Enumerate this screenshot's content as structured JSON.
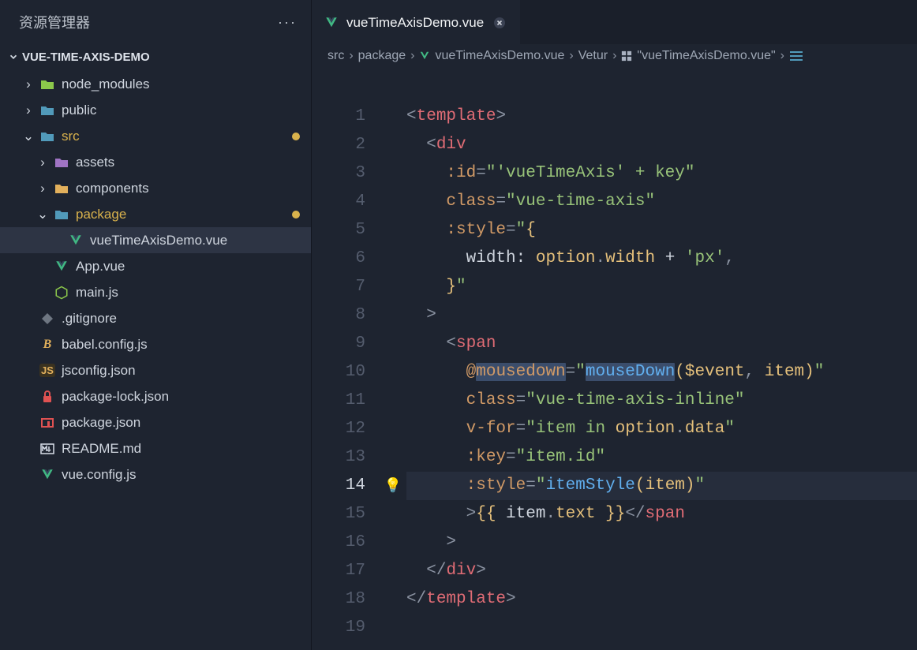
{
  "sidebar": {
    "title": "资源管理器",
    "section": "VUE-TIME-AXIS-DEMO",
    "items": [
      {
        "label": "node_modules",
        "depth": 1,
        "icon": "folder-node",
        "iconColor": "#8cc84b",
        "kind": "folder",
        "open": false,
        "mod": false
      },
      {
        "label": "public",
        "depth": 1,
        "icon": "folder-public",
        "iconColor": "#519aba",
        "kind": "folder",
        "open": false,
        "mod": false
      },
      {
        "label": "src",
        "depth": 1,
        "icon": "folder-src",
        "iconColor": "#519aba",
        "kind": "folder",
        "open": true,
        "mod": true
      },
      {
        "label": "assets",
        "depth": 2,
        "icon": "folder-assets",
        "iconColor": "#a074c4",
        "kind": "folder",
        "open": false,
        "mod": false
      },
      {
        "label": "components",
        "depth": 2,
        "icon": "folder-comp",
        "iconColor": "#e2b05c",
        "kind": "folder",
        "open": false,
        "mod": false
      },
      {
        "label": "package",
        "depth": 2,
        "icon": "folder-pkg",
        "iconColor": "#519aba",
        "kind": "folder",
        "open": true,
        "mod": true
      },
      {
        "label": "vueTimeAxisDemo.vue",
        "depth": 3,
        "icon": "vue",
        "iconColor": "#41b883",
        "kind": "file",
        "selected": true
      },
      {
        "label": "App.vue",
        "depth": 2,
        "icon": "vue",
        "iconColor": "#41b883",
        "kind": "file"
      },
      {
        "label": "main.js",
        "depth": 2,
        "icon": "node",
        "iconColor": "#8cc84b",
        "kind": "file"
      },
      {
        "label": ".gitignore",
        "depth": 1,
        "icon": "git",
        "iconColor": "#6e7681",
        "kind": "file"
      },
      {
        "label": "babel.config.js",
        "depth": 1,
        "icon": "babel",
        "iconColor": "#e2b05c",
        "kind": "file"
      },
      {
        "label": "jsconfig.json",
        "depth": 1,
        "icon": "json",
        "iconColor": "#e2b05c",
        "kind": "file"
      },
      {
        "label": "package-lock.json",
        "depth": 1,
        "icon": "lock",
        "iconColor": "#e05252",
        "kind": "file"
      },
      {
        "label": "package.json",
        "depth": 1,
        "icon": "npm",
        "iconColor": "#e05252",
        "kind": "file"
      },
      {
        "label": "README.md",
        "depth": 1,
        "icon": "md",
        "iconColor": "#d8dee9",
        "kind": "file"
      },
      {
        "label": "vue.config.js",
        "depth": 1,
        "icon": "vue",
        "iconColor": "#41b883",
        "kind": "file"
      }
    ]
  },
  "tab": {
    "label": "vueTimeAxisDemo.vue"
  },
  "breadcrumbs": {
    "parts": [
      "src",
      "package",
      "vueTimeAxisDemo.vue",
      "Vetur",
      "\"vueTimeAxisDemo.vue\""
    ]
  },
  "linecount": 19,
  "code": {
    "filename": "vueTimeAxisDemo.vue",
    "source": "<template>\n  <div\n    :id=\"'vueTimeAxis' + key\"\n    class=\"vue-time-axis\"\n    :style=\"{\n      width: option.width + 'px',\n    }\"\n  >\n    <span\n      @mousedown=\"mouseDown($event, item)\"\n      class=\"vue-time-axis-inline\"\n      v-for=\"item in option.data\"\n      :key=\"item.id\"\n      :style=\"itemStyle(item)\"\n      >{{ item.text }}</span\n    >\n  </div>\n</template>\n",
    "lightbulb_line": 14
  }
}
